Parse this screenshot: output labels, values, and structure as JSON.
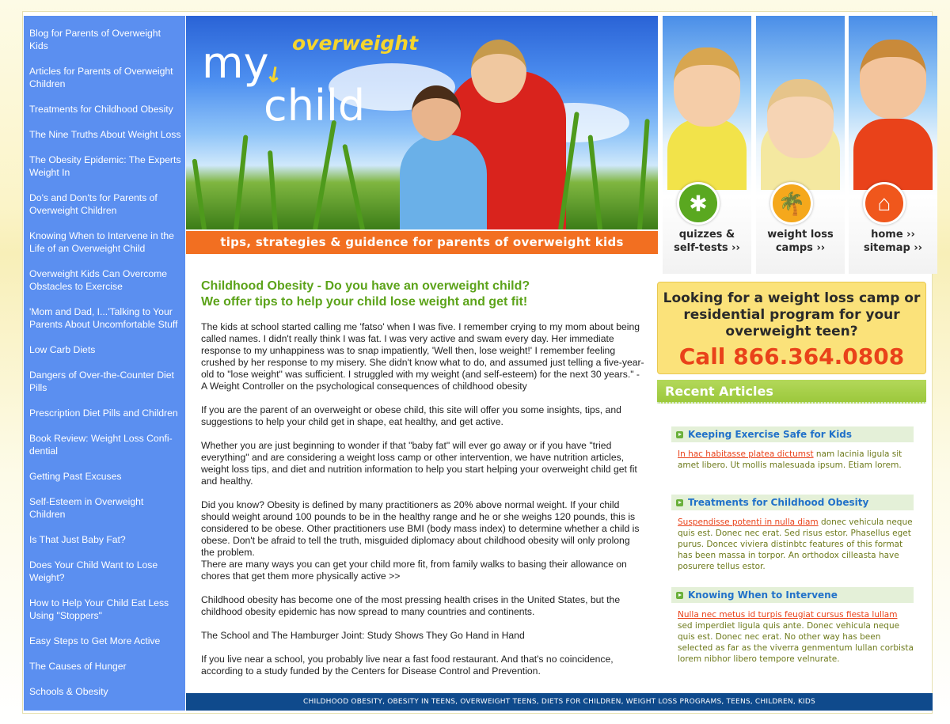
{
  "sidebar": {
    "items": [
      {
        "label": "Blog for Parents of Overweight Kids"
      },
      {
        "label": "Articles for Parents of Overweight Children"
      },
      {
        "label": "Treatments for Childhood Obesity"
      },
      {
        "label": "The Nine Truths About Weight Loss"
      },
      {
        "label": "The Obesity Epidemic: The Experts Weight In"
      },
      {
        "label": "Do's and Don'ts for Parents of Overweight Children"
      },
      {
        "label": "Knowing When to Intervene in the Life of an Overweight Child"
      },
      {
        "label": "Overweight Kids Can Overcome Obstacles to Exercise"
      },
      {
        "label": "'Mom and Dad, I...'Talking to Your Parents About Uncomfortable Stuff"
      },
      {
        "label": "Low Carb Diets"
      },
      {
        "label": "Dangers of Over-the-Counter Diet Pills"
      },
      {
        "label": "Prescription Diet Pills and Children"
      },
      {
        "label": "Book Review: Weight Loss Confi-dential"
      },
      {
        "label": "Getting Past Excuses"
      },
      {
        "label": "Self-Esteem in Overweight Children"
      },
      {
        "label": "Is That Just Baby Fat?"
      },
      {
        "label": "Does Your Child Want to Lose Weight?"
      },
      {
        "label": "How to Help Your Child Eat Less Using \"Stoppers\""
      },
      {
        "label": "Easy Steps to Get More Active"
      },
      {
        "label": "The Causes of Hunger"
      },
      {
        "label": "Schools & Obesity"
      }
    ]
  },
  "header": {
    "logo_my": "my",
    "logo_overweight": "overweight",
    "logo_child": "child",
    "tagline": "tips, strategies & guidence for parents of overweight kids",
    "panels": [
      {
        "line1": "quizzes &",
        "line2": "self-tests ››",
        "icon": "puzzle-icon"
      },
      {
        "line1": "weight loss",
        "line2": "camps ››",
        "icon": "palm-tree-icon"
      },
      {
        "line1": "home ››",
        "line2": "sitemap ››",
        "icon": "house-icon"
      }
    ]
  },
  "main": {
    "heading_line1": "Childhood Obesity - Do you have an overweight child?",
    "heading_line2": "We offer tips to help your child lose weight and get fit!",
    "paragraphs": [
      "The kids at school started calling me 'fatso' when I was five. I remember crying to my mom about being called names. I didn't really think I was fat. I was very active and swam every day. Her immediate response to my unhappiness was to snap impatiently, 'Well then, lose weight!' I remember feeling crushed by her response to my misery. She didn't know what to do, and assumed just telling a five-year-old to \"lose weight\" was sufficient. I struggled with my weight (and self-esteem) for the next 30 years.\" -A Weight Controller on the psychological consequences of childhood obesity",
      "If you are the parent of an overweight or obese child, this site will offer you some insights, tips, and suggestions to help your child get in shape, eat healthy, and get active.",
      "Whether you are just beginning to wonder if that \"baby fat\" will ever go away or if you have \"tried everything\" and are considering a weight loss camp or other intervention, we have nutrition articles, weight loss tips, and diet and nutrition information to help you start helping your overweight child get fit and healthy.",
      "Did you know? Obesity is defined by many practitioners as 20% above normal weight. If your child should weight around 100 pounds to be in the healthy range and he or she weighs 120 pounds, this is considered to be obese. Other practitioners use BMI (body mass index) to determine whether a child is obese. Don't be afraid to tell the truth, misguided diplomacy about childhood obesity will only prolong the problem.",
      "Childhood obesity has become one of the most pressing health crises in the United States, but the childhood obesity epidemic has now spread to many countries and continents.",
      "The School and The Hamburger Joint: Study Shows They Go Hand in Hand",
      "If you live near a school, you probably live near a fast food restaurant. And that's no coincidence, according to a study funded by the Centers for Disease Control and Prevention."
    ],
    "more_text": "There are many ways you can get your child more fit, from family walks to basing their allowance on chores that get them more physically active >>"
  },
  "camp_box": {
    "text": "Looking for a weight loss camp or residential program for your overweight teen?",
    "phone": "Call 866.364.0808"
  },
  "recent": {
    "header": "Recent Articles",
    "articles": [
      {
        "title": "Keeping Exercise Safe for Kids",
        "link": "In hac habitasse platea dictumst",
        "body": " nam lacinia ligula sit amet libero. Ut mollis malesuada ipsum. Etiam lorem."
      },
      {
        "title": "Treatments for Childhood Obesity",
        "link": "Suspendisse potenti in nulla diam",
        "body": " donec vehicula neque quis est. Donec nec erat. Sed risus estor. Phasellus eget purus. Doncec viviera distinbtc features of this format has been massa in torpor. An orthodox cilleasta have posurere tellus estor."
      },
      {
        "title": "Knowing When to Intervene",
        "link": "Nulla nec metus id turpis feugiat cursus fiesta lullam",
        "body": " sed imperdiet ligula quis ante. Donec vehicula neque quis est. Donec nec erat. No other way has been selected as far as the viverra genmentum lullan corbista lorem nibhor libero tempore velnurate."
      }
    ]
  },
  "footer": {
    "text": "CHILDHOOD OBESITY, OBESITY IN TEENS, OVERWEIGHT TEENS, DIETS FOR CHILDREN, WEIGHT LOSS PROGRAMS, TEENS, CHILDREN, KIDS"
  },
  "colors": {
    "sidebar": "#5b8ff0",
    "heading_green": "#5ca31a",
    "tagline_orange": "#f26f21",
    "phone_red": "#e9421a",
    "footer_navy": "#0f4a8c"
  }
}
